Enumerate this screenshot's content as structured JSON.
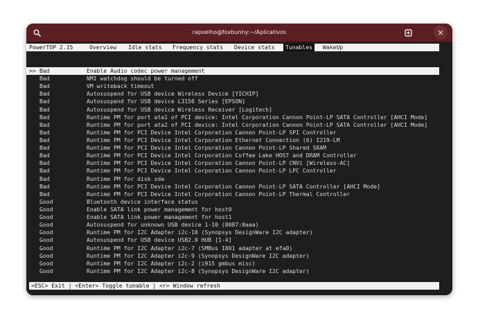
{
  "window": {
    "title": "rapoelho@foxbunny:~/Aplicativos",
    "close_glyph": "✕"
  },
  "powertop": {
    "version_label": "PowerTOP 2.15",
    "tabs": [
      {
        "label": "Overview"
      },
      {
        "label": "Idle stats"
      },
      {
        "label": "Frequency stats"
      },
      {
        "label": "Device stats"
      },
      {
        "label": "Tunables",
        "active": true
      },
      {
        "label": "WakeUp"
      }
    ],
    "selection_marker": ">> ",
    "tunables": [
      {
        "status": "Bad",
        "desc": "Enable Audio codec power management"
      },
      {
        "status": "Bad",
        "desc": "NMI watchdog should be turned off"
      },
      {
        "status": "Bad",
        "desc": "VM writeback timeout"
      },
      {
        "status": "Bad",
        "desc": "Autosuspend for USB device Wireless Device [YICHIP]"
      },
      {
        "status": "Bad",
        "desc": "Autosuspend for USB device L3150 Series [EPSON]"
      },
      {
        "status": "Bad",
        "desc": "Autosuspend for USB device Wireless Receiver [Logitech]"
      },
      {
        "status": "Bad",
        "desc": "Runtime PM for port ata1 of PCI device: Intel Corporation Cannon Point-LP SATA Controller [AHCI Mode]"
      },
      {
        "status": "Bad",
        "desc": "Runtime PM for port ata2 of PCI device: Intel Corporation Cannon Point-LP SATA Controller [AHCI Mode]"
      },
      {
        "status": "Bad",
        "desc": "Runtime PM for PCI Device Intel Corporation Cannon Point-LP SPI Controller"
      },
      {
        "status": "Bad",
        "desc": "Runtime PM for PCI Device Intel Corporation Ethernet Connection (6) I219-LM"
      },
      {
        "status": "Bad",
        "desc": "Runtime PM for PCI Device Intel Corporation Cannon Point-LP Shared SRAM"
      },
      {
        "status": "Bad",
        "desc": "Runtime PM for PCI Device Intel Corporation Coffee Lake HOST and DRAM Controller"
      },
      {
        "status": "Bad",
        "desc": "Runtime PM for PCI Device Intel Corporation Cannon Point-LP CNVi [Wireless-AC]"
      },
      {
        "status": "Bad",
        "desc": "Runtime PM for PCI Device Intel Corporation Cannon Point-LP LPC Controller"
      },
      {
        "status": "Bad",
        "desc": "Runtime PM for disk sda"
      },
      {
        "status": "Bad",
        "desc": "Runtime PM for PCI Device Intel Corporation Cannon Point-LP SATA Controller [AHCI Mode]"
      },
      {
        "status": "Bad",
        "desc": "Runtime PM for PCI Device Intel Corporation Cannon Point-LP Thermal Controller"
      },
      {
        "status": "Good",
        "desc": "Bluetooth device interface status"
      },
      {
        "status": "Good",
        "desc": "Enable SATA link power management for host0"
      },
      {
        "status": "Good",
        "desc": "Enable SATA link power management for host1"
      },
      {
        "status": "Good",
        "desc": "Autosuspend for unknown USB device 1-10 (8087:0aaa)"
      },
      {
        "status": "Good",
        "desc": "Runtime PM for I2C Adapter i2c-10 (Synopsys DesignWare I2C adapter)"
      },
      {
        "status": "Good",
        "desc": "Autosuspend for USB device USB2.0 HUB [1-4]"
      },
      {
        "status": "Good",
        "desc": "Runtime PM for I2C Adapter i2c-7 (SMBus I801 adapter at efa0)"
      },
      {
        "status": "Good",
        "desc": "Runtime PM for I2C Adapter i2c-9 (Synopsys DesignWare I2C adapter)"
      },
      {
        "status": "Good",
        "desc": "Runtime PM for I2C Adapter i2c-2 (i915 gmbus misc)"
      },
      {
        "status": "Good",
        "desc": "Runtime PM for I2C Adapter i2c-8 (Synopsys DesignWare I2C adapter)"
      }
    ],
    "selected_index": 0,
    "footer": "<ESC> Exit | <Enter> Toggle tunable | <r> Window refresh"
  },
  "colors": {
    "titlebar": "#5b1f22",
    "terminal_bg": "#1e1e1e",
    "highlight_bg": "#f2f2f2"
  }
}
